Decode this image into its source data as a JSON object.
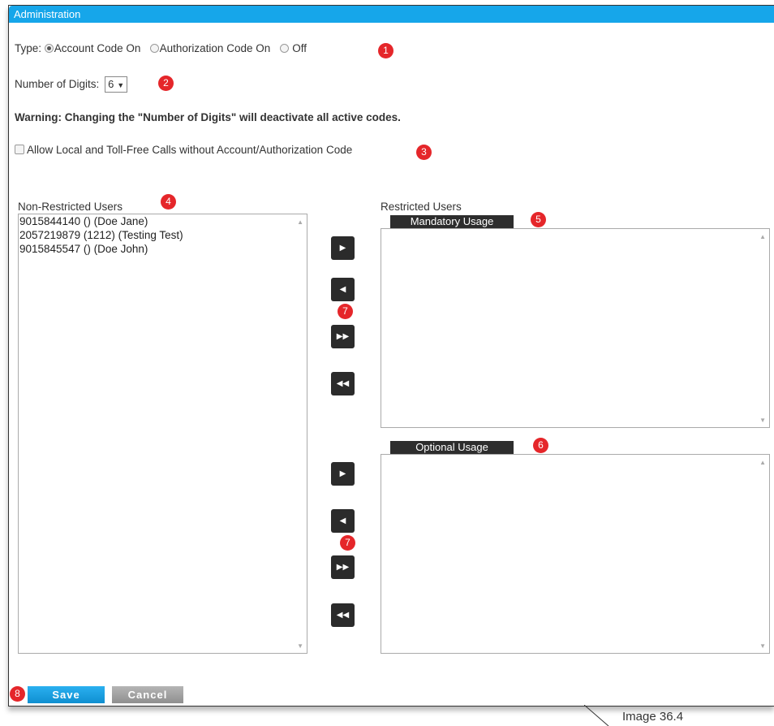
{
  "window": {
    "title": "Administration"
  },
  "type_row": {
    "label": "Type:",
    "options": [
      "Account Code On",
      "Authorization Code On",
      "Off"
    ],
    "selected": "Account Code On"
  },
  "digits": {
    "label": "Number of Digits:",
    "value": "6"
  },
  "warning": "Warning: Changing the \"Number of Digits\" will deactivate all active codes.",
  "allow_local": {
    "label": "Allow Local and Toll-Free Calls without Account/Authorization Code",
    "checked": false
  },
  "non_restricted": {
    "title": "Non-Restricted Users",
    "items": [
      "9015844140 () (Doe Jane)",
      "2057219879 (1212) (Testing Test)",
      "9015845547 () (Doe John)"
    ]
  },
  "restricted": {
    "title": "Restricted Users",
    "mandatory": {
      "title": "Mandatory Usage",
      "items": []
    },
    "optional": {
      "title": "Optional Usage",
      "items": []
    }
  },
  "move_buttons": {
    "move_right": "move-right-icon",
    "move_left": "move-left-icon",
    "move_all_right": "move-all-right-icon",
    "move_all_left": "move-all-left-icon"
  },
  "actions": {
    "save": "Save",
    "cancel": "Cancel"
  },
  "callouts": [
    "1",
    "2",
    "3",
    "4",
    "5",
    "6",
    "7",
    "7",
    "8"
  ],
  "caption": "Image 36.4",
  "colors": {
    "titlebar": "#16a6ea",
    "callout": "#e5262a",
    "save": "#1b9ee0",
    "cancel": "#a3a3a3",
    "section_head": "#2d2d2d"
  }
}
